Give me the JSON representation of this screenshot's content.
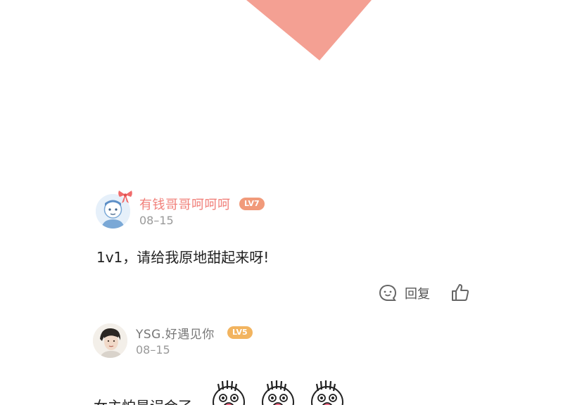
{
  "colors": {
    "triangle": "#f4a093",
    "username_pink": "#f1807a",
    "lv7_badge": "#f19a7a",
    "lv5_badge": "#f2b45f",
    "muted": "#999999"
  },
  "comments": [
    {
      "username": "有钱哥哥呵呵呵",
      "level": "LV7",
      "date": "08–15",
      "text": "1v1，请给我原地甜起来呀!",
      "avatar_icon": "default-avatar-icon",
      "reply_label": "回复"
    },
    {
      "username": "YSG.好遇见你",
      "level": "LV5",
      "date": "08–15",
      "text": "女主怕是误会了",
      "avatar_icon": "user-photo-avatar",
      "stickers": [
        "shocked-face-sticker",
        "shocked-face-sticker",
        "shocked-face-sticker"
      ]
    }
  ]
}
